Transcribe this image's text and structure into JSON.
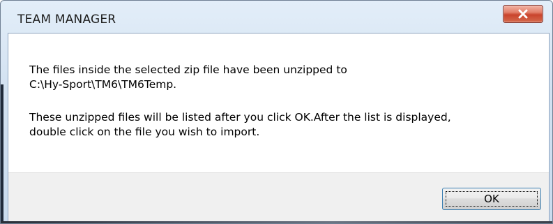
{
  "window": {
    "title": "TEAM MANAGER",
    "close_icon": "close-x-icon"
  },
  "message": {
    "line1": "The files inside the selected zip file have been unzipped to",
    "line2": "C:\\Hy-Sport\\TM6\\TM6Temp.",
    "line3": "These unzipped files will be listed after you click OK.After the list is displayed,",
    "line4": "double click on the file you wish to import."
  },
  "buttons": {
    "ok_label": "OK"
  },
  "colors": {
    "title_bar": "#d2e1f1",
    "close_button": "#c9442d",
    "footer": "#f0f0f0",
    "ok_border": "#3c7fb1"
  }
}
